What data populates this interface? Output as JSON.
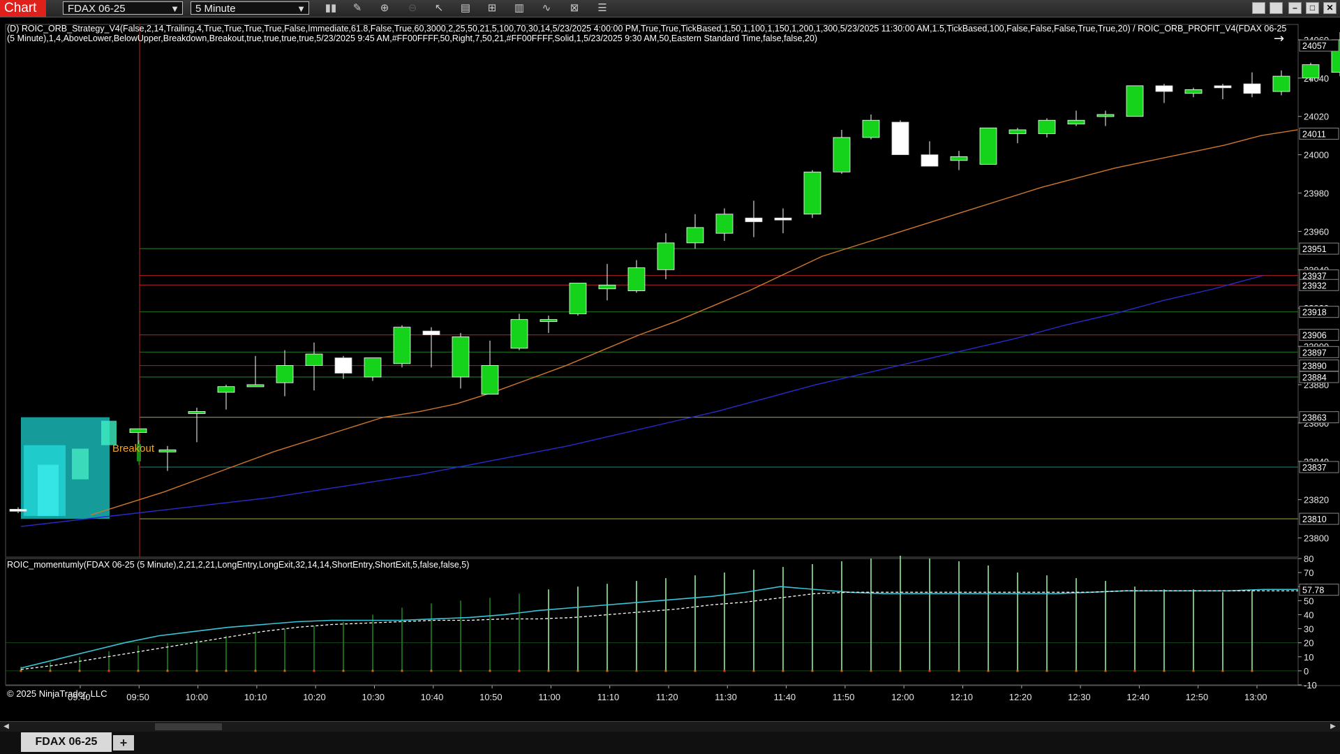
{
  "toolbar": {
    "chart_label": "Chart",
    "instrument": "FDAX 06-25",
    "interval": "5 Minute",
    "icons": [
      "bar-style-icon",
      "drawing-tool-icon",
      "zoom-in-icon",
      "zoom-out-icon",
      "pointer-icon",
      "data-box-icon",
      "indicators-icon",
      "strategies-icon",
      "chart-trader-icon",
      "properties-icon",
      "list-icon"
    ],
    "window_buttons": [
      "tile-icon",
      "tile2-icon",
      "minimize-icon",
      "maximize-icon",
      "close-icon"
    ]
  },
  "strategy_label": "(D) ROIC_ORB_Strategy_V4(False,2,14,Trailing,4,True,True,True,True,False,Immediate,61.8,False,True,60,3000,2,25,50,21,5,100,70,30,14,5/23/2025 4:00:00 PM,True,True,TickBased,1,50,1,100,1,150,1,200,1,300,5/23/2025 11:30:00 AM,1.5,TickBased,100,False,False,False,True,True,20) / ROIC_ORB_PROFIT_V4(FDAX 06-25 (5 Minute),1,4,AboveLower,BelowUpper,Breakdown,Breakout,true,true,true,true,5/23/2025 9:45 AM,#FF00FFFF,50,Right,7,50,21,#FF00FFFF,Solid,1,5/23/2025 9:30 AM,50,Eastern Standard Time,false,false,20)",
  "momentum_label": "ROIC_momentumly(FDAX 06-25 (5 Minute),2,21,2,21,LongEntry,LongExit,32,14,14,ShortEntry,ShortExit,5,false,false,5)",
  "breakout_label": "Breakout",
  "copyright": "© 2025 NinjaTrader, LLC",
  "bottom_tab": "FDAX 06-25",
  "add_tab_label": "+",
  "chart_data": {
    "type": "candlestick",
    "instrument": "FDAX 06-25",
    "interval": "5 Minute",
    "price_axis": {
      "ylim": [
        23790,
        24068
      ],
      "ticks": [
        23800,
        23820,
        23840,
        23860,
        23880,
        23900,
        23920,
        23940,
        23960,
        23980,
        24000,
        24020,
        24040,
        24060
      ]
    },
    "time_axis": {
      "ticks": [
        "09:40",
        "09:50",
        "10:00",
        "10:10",
        "10:20",
        "10:30",
        "10:40",
        "10:50",
        "11:00",
        "11:10",
        "11:20",
        "11:30",
        "11:40",
        "11:50",
        "12:00",
        "12:10",
        "12:20",
        "12:30",
        "12:40",
        "12:50",
        "13:00"
      ]
    },
    "candles": [
      {
        "o": 23815,
        "h": 23816,
        "l": 23813,
        "c": 23814
      },
      {
        "o": 23855,
        "h": 23857,
        "l": 23845,
        "c": 23857
      },
      {
        "o": 23845,
        "h": 23848,
        "l": 23835,
        "c": 23846
      },
      {
        "o": 23865,
        "h": 23868,
        "l": 23850,
        "c": 23866
      },
      {
        "o": 23876,
        "h": 23880,
        "l": 23867,
        "c": 23879
      },
      {
        "o": 23880,
        "h": 23895,
        "l": 23879,
        "c": 23880
      },
      {
        "o": 23881,
        "h": 23898,
        "l": 23874,
        "c": 23890
      },
      {
        "o": 23890,
        "h": 23902,
        "l": 23877,
        "c": 23896
      },
      {
        "o": 23894,
        "h": 23895,
        "l": 23883,
        "c": 23886
      },
      {
        "o": 23884,
        "h": 23892,
        "l": 23882,
        "c": 23894
      },
      {
        "o": 23891,
        "h": 23911,
        "l": 23889,
        "c": 23910
      },
      {
        "o": 23908,
        "h": 23910,
        "l": 23889,
        "c": 23906
      },
      {
        "o": 23884,
        "h": 23907,
        "l": 23878,
        "c": 23905
      },
      {
        "o": 23875,
        "h": 23903,
        "l": 23875,
        "c": 23890
      },
      {
        "o": 23899,
        "h": 23917,
        "l": 23898,
        "c": 23914
      },
      {
        "o": 23914,
        "h": 23916,
        "l": 23907,
        "c": 23914
      },
      {
        "o": 23917,
        "h": 23933,
        "l": 23916,
        "c": 23933
      },
      {
        "o": 23930,
        "h": 23943,
        "l": 23924,
        "c": 23932
      },
      {
        "o": 23929,
        "h": 23945,
        "l": 23928,
        "c": 23941
      },
      {
        "o": 23940,
        "h": 23959,
        "l": 23935,
        "c": 23954
      },
      {
        "o": 23954,
        "h": 23969,
        "l": 23951,
        "c": 23962
      },
      {
        "o": 23959,
        "h": 23972,
        "l": 23955,
        "c": 23969
      },
      {
        "o": 23967,
        "h": 23976,
        "l": 23957,
        "c": 23965
      },
      {
        "o": 23967,
        "h": 23972,
        "l": 23959,
        "c": 23966
      },
      {
        "o": 23969,
        "h": 23992,
        "l": 23967,
        "c": 23991
      },
      {
        "o": 23991,
        "h": 24013,
        "l": 23990,
        "c": 24009
      },
      {
        "o": 24009,
        "h": 24021,
        "l": 24008,
        "c": 24018
      },
      {
        "o": 24017,
        "h": 24018,
        "l": 24000,
        "c": 24000
      },
      {
        "o": 24000,
        "h": 24007,
        "l": 23994,
        "c": 23994
      },
      {
        "o": 23997,
        "h": 24002,
        "l": 23992,
        "c": 23999
      },
      {
        "o": 23995,
        "h": 24014,
        "l": 23995,
        "c": 24014
      },
      {
        "o": 24011,
        "h": 24014,
        "l": 24006,
        "c": 24013
      },
      {
        "o": 24011,
        "h": 24019,
        "l": 24009,
        "c": 24018
      },
      {
        "o": 24016,
        "h": 24023,
        "l": 24015,
        "c": 24018
      },
      {
        "o": 24020,
        "h": 24023,
        "l": 24015,
        "c": 24021
      },
      {
        "o": 24020,
        "h": 24036,
        "l": 24020,
        "c": 24036
      },
      {
        "o": 24036,
        "h": 24037,
        "l": 24027,
        "c": 24033
      },
      {
        "o": 24032,
        "h": 24035,
        "l": 24030,
        "c": 24034
      },
      {
        "o": 24036,
        "h": 24037,
        "l": 24029,
        "c": 24035
      },
      {
        "o": 24037,
        "h": 24043,
        "l": 24030,
        "c": 24032
      },
      {
        "o": 24033,
        "h": 24044,
        "l": 24031,
        "c": 24041
      },
      {
        "o": 24040,
        "h": 24048,
        "l": 24038,
        "c": 24047
      },
      {
        "o": 24043,
        "h": 24064,
        "l": 24041,
        "c": 24060
      }
    ],
    "breakout_candle": {
      "o": 23849,
      "h": 23851,
      "l": 23838,
      "c": 23840
    },
    "opening_range_box": {
      "high": 23863,
      "low": 23810
    },
    "levels": [
      {
        "value": 23951,
        "color": "#1f6e1f",
        "label": "23951"
      },
      {
        "value": 23937,
        "color": "#9b1c1c",
        "label": "23937"
      },
      {
        "value": 23932,
        "color": "#9b1c1c",
        "label": "23932"
      },
      {
        "value": 23918,
        "color": "#1f6e1f",
        "label": "23918"
      },
      {
        "value": 23906,
        "color": "#9b1c1c",
        "label": "23906"
      },
      {
        "value": 23897,
        "color": "#1f6e1f",
        "label": "23897"
      },
      {
        "value": 23890,
        "color": "#9b1c1c",
        "label": "23890"
      },
      {
        "value": 23884,
        "color": "#1f6e1f",
        "label": "23884"
      },
      {
        "value": 23863,
        "color": "#8a8a1f",
        "label": "23863"
      },
      {
        "value": 23837,
        "color": "#1f6e6e",
        "label": "23837"
      },
      {
        "value": 23810,
        "color": "#8a8a1f",
        "label": "23810"
      }
    ],
    "price_labels": [
      "24057",
      "24011"
    ],
    "ma_fast": [
      23812,
      23818,
      23824,
      23831,
      23838,
      23845,
      23851,
      23857,
      23863,
      23866,
      23870,
      23876,
      23883,
      23890,
      23898,
      23906,
      23913,
      23921,
      23929,
      23938,
      23947,
      23953,
      23959,
      23965,
      23971,
      23977,
      23983,
      23988,
      23993,
      23997,
      24001,
      24005,
      24010,
      24013
    ],
    "ma_slow": [
      23806,
      23809,
      23812,
      23815,
      23818,
      23821,
      23825,
      23829,
      23833,
      23838,
      23843,
      23848,
      23854,
      23860,
      23866,
      23873,
      23880,
      23886,
      23892,
      23898,
      23904,
      23911,
      23917,
      23924,
      23930,
      23937
    ],
    "momentum": {
      "ylim": [
        -10,
        80
      ],
      "ticks": [
        -10,
        0,
        10,
        20,
        30,
        40,
        50,
        60,
        70,
        80
      ],
      "current_value": "57.78",
      "line": [
        2,
        8,
        14,
        20,
        25,
        28,
        31,
        33,
        35,
        36,
        36,
        36,
        37,
        38,
        40,
        43,
        45,
        47,
        49,
        51,
        53,
        56,
        60,
        58,
        56,
        55,
        55,
        55,
        55,
        55,
        55,
        56,
        57,
        57,
        57,
        57,
        58,
        58
      ],
      "signal": [
        1,
        4,
        8,
        12,
        16,
        20,
        24,
        28,
        31,
        33,
        34,
        35,
        36,
        36,
        37,
        37,
        38,
        40,
        42,
        44,
        47,
        49,
        52,
        55,
        56,
        56,
        56,
        56,
        56,
        56,
        56,
        56,
        57,
        57,
        57,
        57,
        57,
        57
      ],
      "bars": [
        3,
        6,
        10,
        14,
        18,
        20,
        22,
        25,
        28,
        30,
        32,
        35,
        40,
        45,
        48,
        50,
        52,
        55,
        58,
        60,
        62,
        64,
        66,
        68,
        70,
        72,
        74,
        76,
        78,
        80,
        82,
        80,
        78,
        75,
        70,
        68,
        66,
        64,
        60,
        58,
        58,
        56,
        57
      ]
    }
  }
}
